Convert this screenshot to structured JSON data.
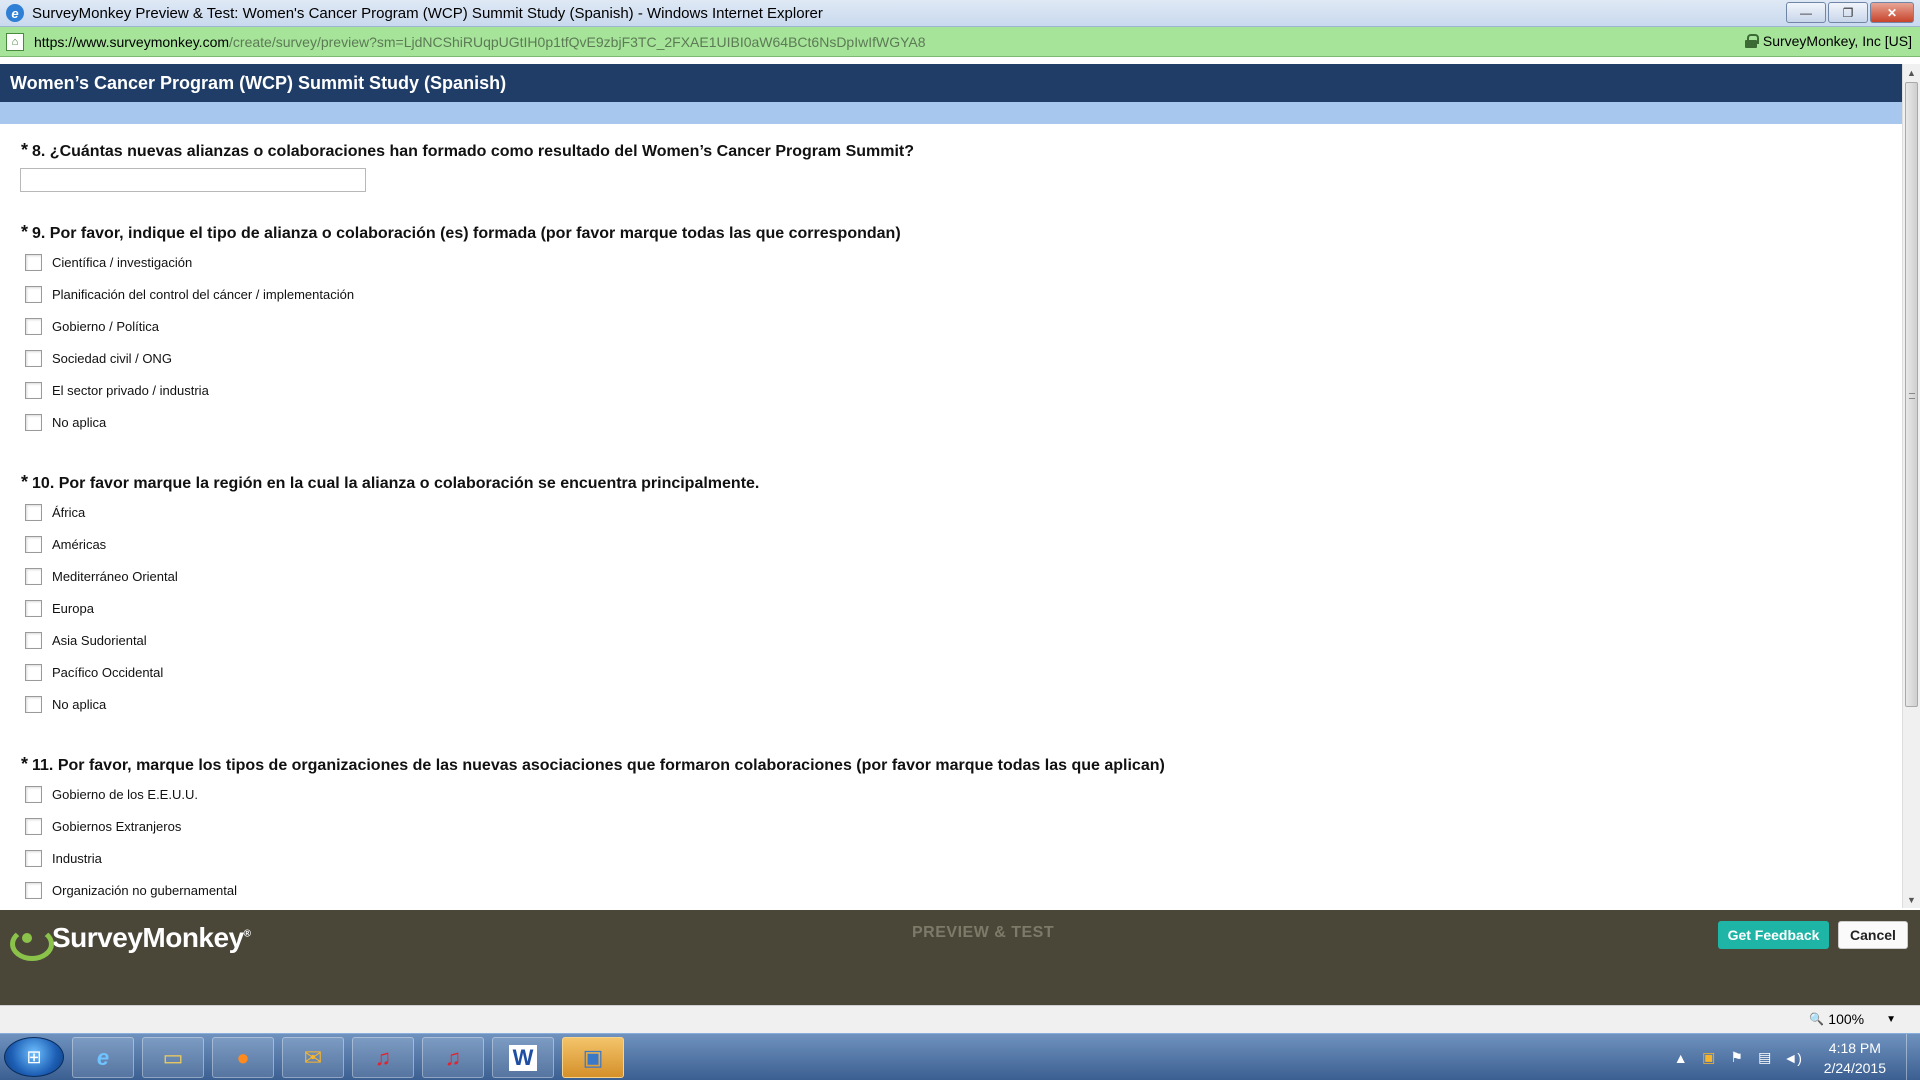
{
  "window": {
    "title": "SurveyMonkey Preview & Test: Women's Cancer Program (WCP) Summit Study (Spanish) - Windows Internet Explorer",
    "minimize": "—",
    "restore": "❐",
    "close": "✕"
  },
  "address": {
    "url_host": "https://www.surveymonkey.com",
    "url_path": "/create/survey/preview?sm=LjdNCShiRUqpUGtIH0p1tfQvE9zbjF3TC_2FXAE1UIBI0aW64BCt6NsDpIwIfWGYA8",
    "identity": "SurveyMonkey, Inc [US]"
  },
  "survey": {
    "title": "Women’s Cancer Program (WCP) Summit Study (Spanish)",
    "questions": [
      {
        "required_mark": "*",
        "title": "8. ¿Cuántas nuevas alianzas o colaboraciones han formado como resultado del Women’s Cancer Program Summit?"
      },
      {
        "required_mark": "*",
        "title": "9. Por favor, indique el tipo de alianza o colaboración (es) formada (por favor marque todas las que correspondan)",
        "options": [
          "Científica / investigación",
          "Planificación del control del cáncer / implementación",
          "Gobierno / Política",
          "Sociedad civil / ONG",
          "El sector privado / industria",
          "No aplica"
        ]
      },
      {
        "required_mark": "*",
        "title": "10. Por favor marque la región en la cual la alianza o colaboración se encuentra  principalmente.",
        "options": [
          "África",
          "Américas",
          "Mediterráneo Oriental",
          "Europa",
          "Asia Sudoriental",
          "Pacífico Occidental",
          "No aplica"
        ]
      },
      {
        "required_mark": "*",
        "title": "11. Por favor, marque los tipos de organizaciones de las nuevas asociaciones que formaron colaboraciones (por favor marque todas las que aplican)",
        "options": [
          "Gobierno de los E.E.U.U.",
          "Gobiernos Extranjeros",
          "Industria",
          "Organización no gubernamental"
        ]
      }
    ]
  },
  "footer": {
    "logo_text": "SurveyMonkey",
    "logo_mark": "®",
    "mode_label": "PREVIEW & TEST",
    "feedback_button": "Get Feedback",
    "cancel_button": "Cancel"
  },
  "statusbar": {
    "zoom": "100%"
  },
  "taskbar": {
    "time": "4:18 PM",
    "date": "2/24/2015"
  }
}
